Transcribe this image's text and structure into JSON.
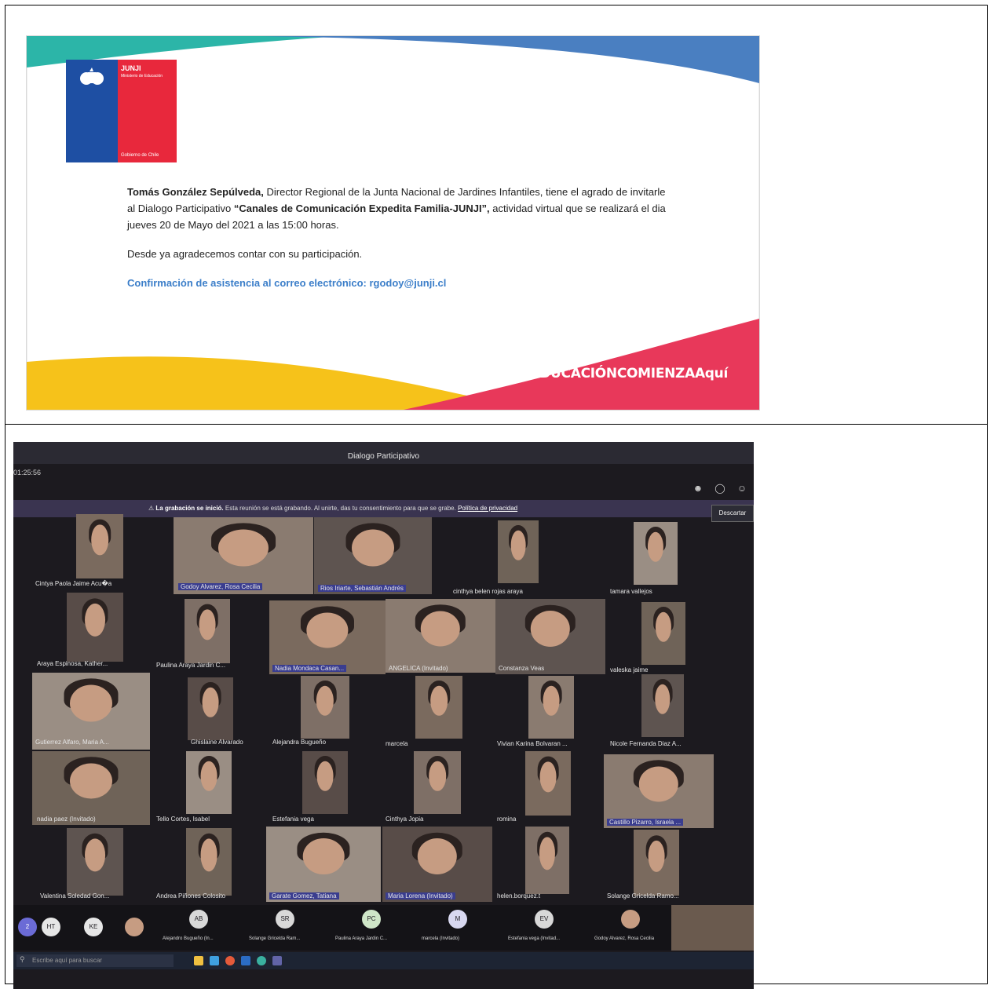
{
  "invitation": {
    "logo": {
      "org": "JUNJI",
      "ministry": "Ministerio de Educación",
      "footer": "Gobierno de Chile"
    },
    "paragraph1": {
      "bold_name": "Tomás González Sepúlveda,",
      "mid1": " Director Regional de la Junta Nacional de Jardines Infantiles, tiene el agrado de invitarle al Dialogo Participativo ",
      "bold_title": "“Canales de Comunicación Expedita Familia-JUNJI”,",
      "mid2": " actividad virtual que se realizará el dia jueves 20 de Mayo del 2021 a las 15:00 horas."
    },
    "paragraph2": "Desde ya agradecemos contar con su participación.",
    "confirmation": "Confirmación de asistencia al correo electrónico: rgodoy@junji.cl",
    "hashtag": "#laEDUCACIÓNCOMIENZAAquí",
    "colors": {
      "teal": "#2cb5a8",
      "blue": "#4a7fc1",
      "red": "#e8385a",
      "yellow": "#f6c21a"
    }
  },
  "meeting": {
    "title": "Dialogo Participativo",
    "clock": "01:25:56",
    "recording_notice": {
      "bold": "La grabación se inició.",
      "text": " Esta reunión se está grabando. Al unirte, das tu consentimiento para que se grabe. ",
      "link": "Política de privacidad"
    },
    "discard_button": "Descartar",
    "participants": [
      "Cintya Paola Jaime Acu�a",
      "Godoy Alvarez, Rosa Cecilia",
      "Rios Iriarte, Sebastián Andrés",
      "cinthya belen rojas araya",
      "tamara vallejos",
      "Araya Espinosa, Kather...",
      "Paulina Araya Jardin C...",
      "Nadia Mondaca Casan...",
      "ANGELICA (Invitado)",
      "Constanza Veas",
      "valeska jaime",
      "Gutierrez Alfaro, Maria A...",
      "Ghislaine Alvarado",
      "Alejandra Bugueño",
      "marcela",
      "Vivian Karina Bolvaran ...",
      "Nicole Fernanda Diaz A...",
      "nadia paez (Invitado)",
      "Tello Cortes, Isabel",
      "Estefania vega",
      "Cinthya Jopia",
      "romina",
      "Castillo Pizarro, Israela ...",
      "Valentina Soledad Gon...",
      "Andrea Piñones Colosito",
      "Garate Gomez, Tatiana",
      "Maria Lorena (Invitado)",
      "helen.borquez.t",
      "Solange Gricelda Ramo..."
    ],
    "bottom_avatars": [
      {
        "initials": "HT"
      },
      {
        "initials": "KE"
      }
    ],
    "bottom_people": [
      {
        "initials": "AB",
        "name": "Alejandro Bugueño (In..."
      },
      {
        "initials": "SR",
        "name": "Solange Gricelda Ram..."
      },
      {
        "initials": "PC",
        "name": "Paulina Araya Jardin C..."
      },
      {
        "initials": "M",
        "name": "marcela (Invitado)"
      },
      {
        "initials": "EV",
        "name": "Estefania vega (Invitad..."
      },
      {
        "initials": "",
        "name": "Godoy Alvarez, Rosa Cecilia"
      }
    ],
    "left_badge": "2",
    "search_placeholder": "Escribe aquí para buscar"
  }
}
